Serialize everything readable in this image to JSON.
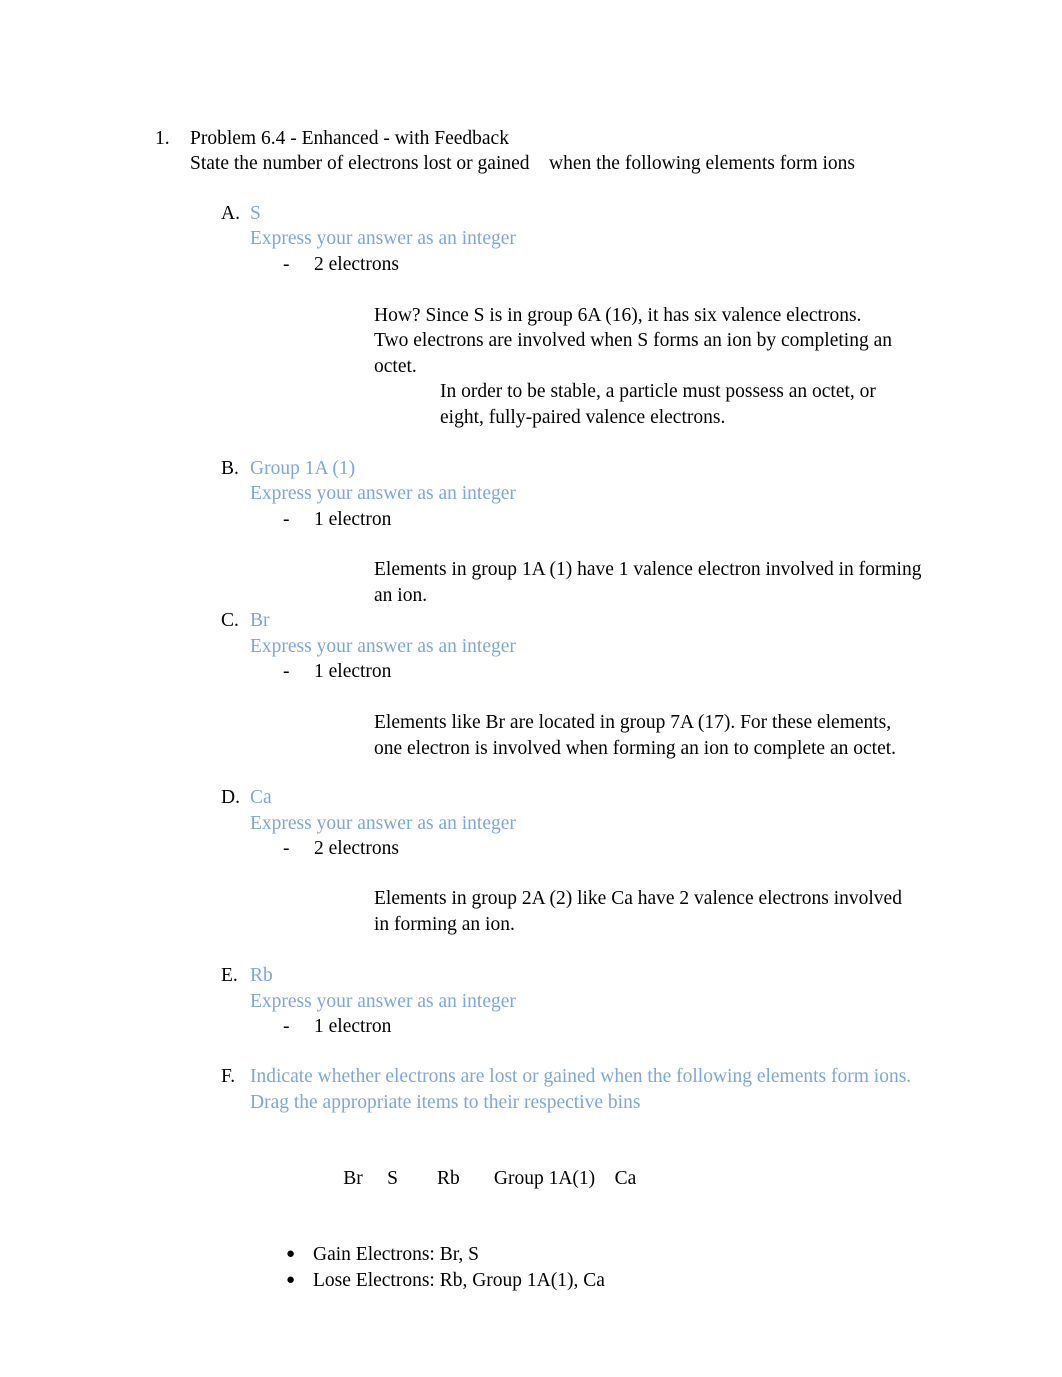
{
  "document": {
    "problem": {
      "marker": "1.",
      "title": "Problem 6.4 - Enhanced - with Feedback",
      "prompt_part1": "State the number of electrons lost or gained",
      "prompt_gap": "    ",
      "prompt_part2": "when the following elements form ions",
      "prompt_full": "State the number of electrons lost or gained    when the following elements form ions"
    },
    "answer_marker": "-",
    "express_label": "Express your answer as an integer",
    "parts": [
      {
        "marker": "A.",
        "subject": "S",
        "express": "Express your answer as an integer",
        "answer": "2 electrons",
        "explanation": "How? Since S is in group 6A (16), it has six valence electrons. Two electrons are involved when S forms an ion by completing an octet.",
        "explanation_indented": "In order to be stable, a particle must possess an octet, or eight, fully-paired valence electrons."
      },
      {
        "marker": "B.",
        "subject": "Group 1A (1)",
        "express": "Express your answer as an integer",
        "answer": "1 electron",
        "explanation": "Elements in group 1A (1) have 1 valence electron involved in forming an ion."
      },
      {
        "marker": "C.",
        "subject": "Br",
        "express": "Express your answer as an integer",
        "answer": "1 electron",
        "explanation": "Elements like Br are located in group 7A (17). For these elements, one electron is involved when forming an ion to complete an octet."
      },
      {
        "marker": "D.",
        "subject": "Ca",
        "express": "Express your answer as an integer",
        "answer": "2 electrons",
        "explanation": "Elements in group 2A (2) like Ca have 2 valence electrons involved in forming an ion."
      },
      {
        "marker": "E.",
        "subject": "Rb",
        "express": "Express your answer as an integer",
        "answer": "1 electron"
      },
      {
        "marker": "F.",
        "instruction_line1": "Indicate whether electrons are lost or gained when the following elements form ions.",
        "instruction_line2": "Drag the appropriate items to their respective bins",
        "drag_items_line": "Br\tS\tRb\tGroup 1A(1)\tCa",
        "drag_items": [
          "Br",
          "S",
          "Rb",
          "Group 1A(1)",
          "Ca"
        ],
        "bins": [
          {
            "label": "Gain Electrons:",
            "contents": "Br, S",
            "text": "Gain Electrons: Br, S"
          },
          {
            "label": "Lose Electrons:",
            "contents": "Rb, Group 1A(1), Ca",
            "text": "Lose Electrons: Rb, Group 1A(1), Ca"
          }
        ]
      }
    ]
  },
  "colors": {
    "page_background": "#ffffff",
    "body_text": "#000000",
    "accent_blue": "#7da7d9"
  }
}
